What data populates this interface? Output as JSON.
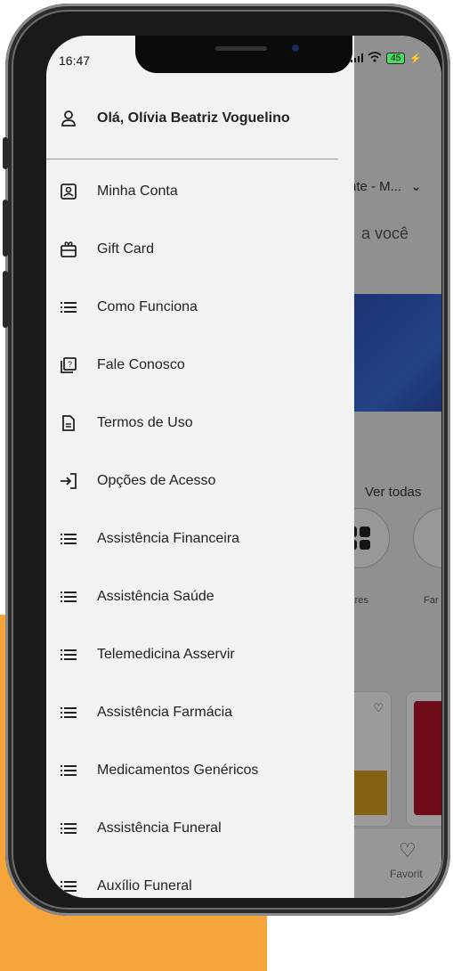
{
  "status_bar": {
    "time": "16:47",
    "battery": "45"
  },
  "background_app": {
    "dropdown_text": "nte - M...",
    "subtitle_text": "a você",
    "see_all_link": "Ver todas",
    "category_label_1": "ulares",
    "category_label_2": "Far",
    "tab_favorites": "Favorit"
  },
  "drawer": {
    "greeting": "Olá, Olívia Beatriz Voguelino",
    "items": [
      {
        "label": "Minha Conta",
        "icon": "account-card-icon"
      },
      {
        "label": "Gift Card",
        "icon": "gift-card-icon"
      },
      {
        "label": "Como Funciona",
        "icon": "list-icon"
      },
      {
        "label": "Fale Conosco",
        "icon": "help-chat-icon"
      },
      {
        "label": "Termos de Uso",
        "icon": "document-icon"
      },
      {
        "label": "Opções de Acesso",
        "icon": "login-icon"
      },
      {
        "label": "Assistência Financeira",
        "icon": "list-icon"
      },
      {
        "label": "Assistência Saúde",
        "icon": "list-icon"
      },
      {
        "label": "Telemedicina Asservir",
        "icon": "list-icon"
      },
      {
        "label": "Assistência Farmácia",
        "icon": "list-icon"
      },
      {
        "label": "Medicamentos Genéricos",
        "icon": "list-icon"
      },
      {
        "label": "Assistência Funeral",
        "icon": "list-icon"
      },
      {
        "label": "Auxílio Funeral",
        "icon": "list-icon"
      }
    ]
  },
  "colors": {
    "accent_orange": "#f5a53a",
    "drawer_bg": "#f2f2f2"
  }
}
